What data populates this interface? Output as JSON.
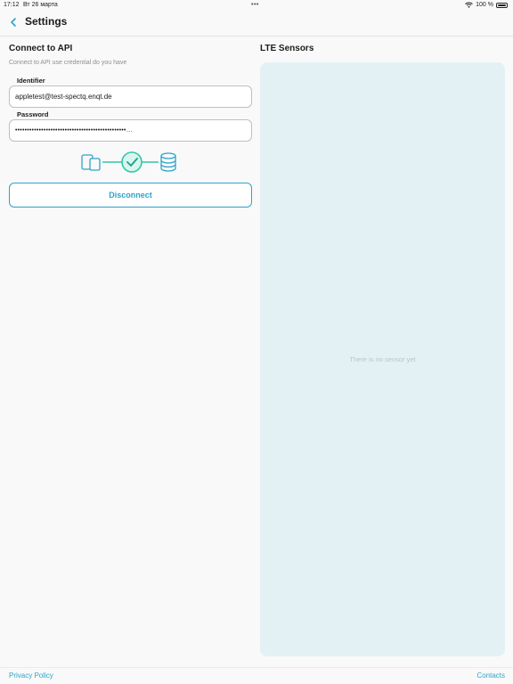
{
  "status_bar": {
    "time": "17:12",
    "date": "Вт 26 марта",
    "dots": "•••",
    "battery": "100 %"
  },
  "nav": {
    "title": "Settings",
    "back_icon": "chevron-left-icon"
  },
  "api": {
    "title": "Connect to API",
    "subtitle": "Connect to API use credential do you have",
    "identifier_label": "Identifier",
    "identifier_value": "appletest@test-spectq.enqt.de",
    "password_label": "Password",
    "password_value": "•••••••••••••••••••••••••••••••••••••••••••••••…",
    "disconnect_label": "Disconnect"
  },
  "sensors": {
    "title": "LTE Sensors",
    "empty_text": "There is no sensor yet"
  },
  "footer": {
    "privacy": "Privacy Policy",
    "contacts": "Contacts"
  },
  "colors": {
    "accent": "#2ea3c9",
    "success": "#2fc7a8",
    "panel": "#e4f1f4",
    "background": "#f9f9f9"
  }
}
